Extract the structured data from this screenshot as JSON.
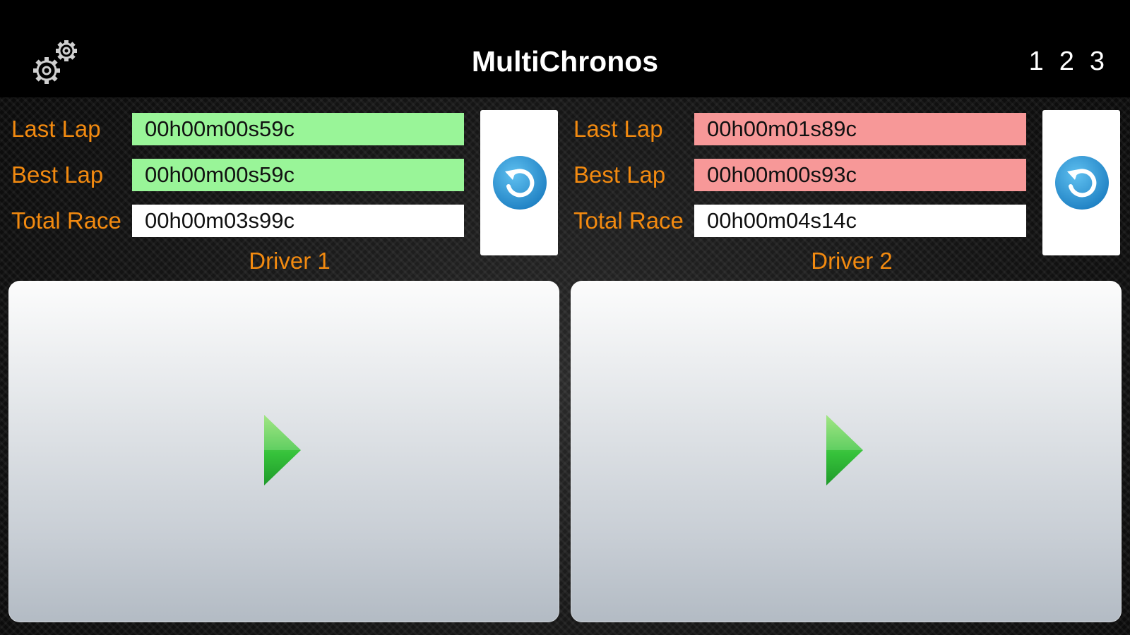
{
  "header": {
    "title": "MultiChronos",
    "settings_icon": "gears-icon",
    "pages": [
      "1",
      "2",
      "3"
    ]
  },
  "colors": {
    "label_orange": "#f28a10",
    "field_green": "#99f598",
    "field_red": "#f79898",
    "field_white": "#ffffff",
    "reset_blue": "#2a8fd0",
    "play_green": "#36c23b"
  },
  "drivers": [
    {
      "name": "Driver 1",
      "last_lap_label": "Last Lap",
      "last_lap": "00h00m00s59c",
      "best_lap_label": "Best Lap",
      "best_lap": "00h00m00s59c",
      "total_race_label": "Total Race",
      "total_race": "00h00m03s99c",
      "lap_status": "green",
      "reset_icon": "reset-icon",
      "play_icon": "play-icon"
    },
    {
      "name": "Driver 2",
      "last_lap_label": "Last Lap",
      "last_lap": "00h00m01s89c",
      "best_lap_label": "Best Lap",
      "best_lap": "00h00m00s93c",
      "total_race_label": "Total Race",
      "total_race": "00h00m04s14c",
      "lap_status": "red",
      "reset_icon": "reset-icon",
      "play_icon": "play-icon"
    }
  ]
}
